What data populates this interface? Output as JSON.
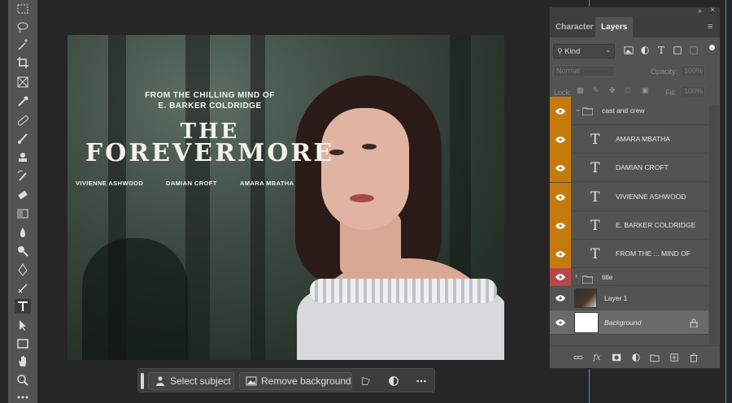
{
  "toolbar": {
    "tools": [
      {
        "name": "marquee-tool-icon"
      },
      {
        "name": "lasso-tool-icon"
      },
      {
        "name": "magic-wand-tool-icon"
      },
      {
        "name": "crop-tool-icon"
      },
      {
        "name": "frame-tool-icon"
      },
      {
        "name": "eyedropper-tool-icon"
      },
      {
        "name": "healing-brush-tool-icon"
      },
      {
        "name": "brush-tool-icon"
      },
      {
        "name": "clone-stamp-tool-icon"
      },
      {
        "name": "history-brush-tool-icon"
      },
      {
        "name": "eraser-tool-icon"
      },
      {
        "name": "gradient-tool-icon"
      },
      {
        "name": "blur-tool-icon"
      },
      {
        "name": "dodge-tool-icon"
      },
      {
        "name": "pen-tool-icon"
      },
      {
        "name": "type-tool-icon",
        "active": true
      },
      {
        "name": "path-selection-tool-icon"
      },
      {
        "name": "rectangle-tool-icon"
      },
      {
        "name": "hand-tool-icon"
      },
      {
        "name": "zoom-tool-icon"
      },
      {
        "name": "more-tools-icon"
      }
    ]
  },
  "poster": {
    "tagline_1": "FROM THE CHILLING MIND OF",
    "tagline_2": "E. BARKER COLDRIDGE",
    "title_1": "THE",
    "title_2": "FOREVERMORE",
    "cast": [
      "VIVIENNE ASHWOOD",
      "DAMIAN CROFT",
      "AMARA MBATHA"
    ]
  },
  "taskbar": {
    "select_subject": "Select subject",
    "remove_background": "Remove background"
  },
  "panel": {
    "tabs": [
      "Character",
      "Layers"
    ],
    "active_tab": "Layers",
    "filter_kind": "Kind",
    "blend_mode": "Normal",
    "opacity_label": "Opacity:",
    "opacity_value": "100%",
    "lock_label": "Lock:",
    "fill_label": "Fill:",
    "fill_value": "100%",
    "layers": [
      {
        "name": "cast and crew",
        "type": "group-open",
        "label_color": "#c67a0c"
      },
      {
        "name": "AMARA MBATHA",
        "type": "text",
        "label_color": "#c67a0c"
      },
      {
        "name": "DAMIAN CROFT",
        "type": "text",
        "label_color": "#c67a0c"
      },
      {
        "name": "VIVIENNE ASHWOOD",
        "type": "text",
        "label_color": "#c67a0c"
      },
      {
        "name": "E. BARKER COLDRIDGE",
        "type": "text",
        "label_color": "#c67a0c"
      },
      {
        "name": "FROM THE ... MIND OF",
        "type": "text",
        "label_color": "#c67a0c"
      },
      {
        "name": "title",
        "type": "group-closed",
        "label_color": "#b6484b"
      },
      {
        "name": "Layer 1",
        "type": "image"
      },
      {
        "name": "Background",
        "type": "background",
        "locked": true,
        "selected": true
      }
    ],
    "footer_icons": [
      "link-icon",
      "fx-icon",
      "mask-icon",
      "adjustment-icon",
      "group-folder-icon",
      "new-layer-icon",
      "trash-icon"
    ]
  },
  "colors": {
    "accent_orange": "#c67a0c",
    "accent_red": "#b6484b",
    "guide_cyan": "#28a7c9"
  }
}
